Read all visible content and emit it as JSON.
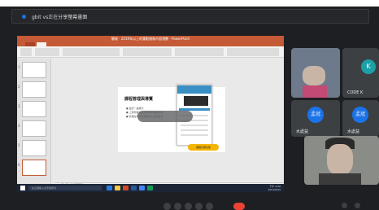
{
  "meet": {
    "window_title": "gbit vs正在分享螢幕畫面"
  },
  "powerpoint": {
    "title": "簡報 - 2019年以上的重點服務內容規劃 - PowerPoint",
    "slide_numbers": [
      "1",
      "2",
      "3",
      "4",
      "5",
      "6"
    ],
    "slide": {
      "title": "課程管理與導覽",
      "bullets": [
        "● 設定一般顯示",
        "● 上傳作業或其他教材的檔案內容",
        "● 管理在學學生與教學公告的設定"
      ],
      "cta": "課程管理功能"
    },
    "notes_placeholder": "按一下以新增備忘稿",
    "status_left": "投影片 6/18　中文 (台灣)",
    "status_right": "備忘稿　註解　　　　　　　　　　 - + 69%"
  },
  "taskbar": {
    "search_placeholder": "在這裡輸入文字來搜尋",
    "clock_time": "下午 4:58",
    "clock_date": "2021/6/22"
  },
  "participants": [
    {
      "name": "",
      "kind": "video"
    },
    {
      "name": "CODE K",
      "kind": "avatar",
      "initial": "K"
    },
    {
      "name": "水處益",
      "kind": "avatar",
      "initial": "孟冠"
    },
    {
      "name": "水處益",
      "kind": "avatar",
      "initial": "孟冠"
    },
    {
      "name": "",
      "kind": "video"
    }
  ],
  "colors": {
    "meet_bg": "#1e1f22",
    "tile_bg": "#3c4043",
    "ppt_accent": "#c55a36",
    "avatar_blue": "#1a73e8",
    "avatar_teal": "#1aa1a8",
    "leave_red": "#ea4335"
  },
  "icons": [
    "mic-icon",
    "camera-icon",
    "captions-icon",
    "present-icon",
    "more-icon",
    "leave-call-icon"
  ]
}
